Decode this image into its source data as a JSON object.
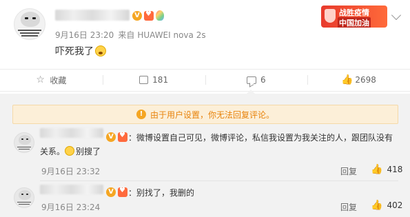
{
  "post": {
    "time": "9月16日 23:20",
    "source_label": "来自",
    "device": "HUAWEI nova 2s",
    "text": "吓死我了"
  },
  "promo": {
    "line1": "战胜疫情",
    "line2": "中国加油"
  },
  "actions": [
    {
      "icon": "star-icon",
      "label": "收藏"
    },
    {
      "icon": "share-icon",
      "label": "181"
    },
    {
      "icon": "comment-icon",
      "label": "6"
    },
    {
      "icon": "like-icon",
      "label": "2698"
    }
  ],
  "notice": "由于用户设置，你无法回复评论。",
  "comments": [
    {
      "text_line1": "：微博设置自己可见，微博评论，私信我设置为我关注的人，跟团队没有",
      "text_line2_prefix": "关系。",
      "text_line2_rest": "别搜了",
      "time": "9月16日 23:32",
      "reply": "回复",
      "likes": "418"
    },
    {
      "text_line1": "：别找了，我删的",
      "time": "9月16日 23:24",
      "reply": "回复",
      "likes": "402"
    }
  ],
  "colors": {
    "accent": "#f5a623",
    "notice_text": "#e8830c",
    "notice_bg": "#fcefd8",
    "promo_red": "#e83a2c"
  }
}
